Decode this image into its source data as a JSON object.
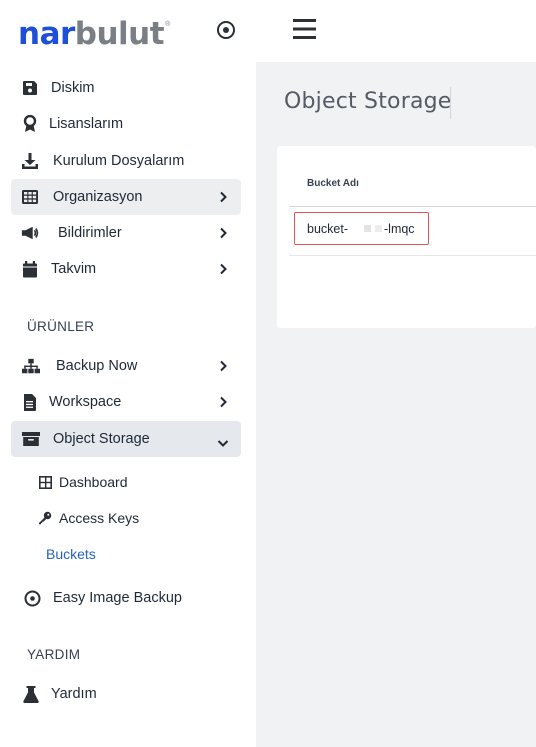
{
  "brand": {
    "part1": "nar",
    "part2": "bulut",
    "reg": "®"
  },
  "sidebar": {
    "items": [
      {
        "label": "Diskim"
      },
      {
        "label": "Lisanslarım"
      },
      {
        "label": "Kurulum Dosyalarım"
      },
      {
        "label": "Organizasyon"
      },
      {
        "label": "Bildirimler"
      },
      {
        "label": "Takvim"
      }
    ],
    "section_products": "ÜRÜNLER",
    "products": [
      {
        "label": "Backup Now"
      },
      {
        "label": "Workspace"
      },
      {
        "label": "Object Storage"
      }
    ],
    "object_storage_sub": [
      {
        "label": "Dashboard"
      },
      {
        "label": "Access Keys"
      },
      {
        "label": "Buckets"
      }
    ],
    "easy_image_backup": "Easy Image Backup",
    "section_help": "YARDIM",
    "help": "Yardım"
  },
  "main": {
    "title": "Object Storage",
    "table": {
      "header": "Bucket Adı",
      "rows": [
        {
          "prefix": "bucket-",
          "suffix": "-lmqc"
        }
      ]
    }
  },
  "colors": {
    "accent": "#2563b8",
    "highlight_border": "#e05555",
    "brand_blue": "#1d4fd8",
    "brand_gray": "#7a7f85"
  }
}
